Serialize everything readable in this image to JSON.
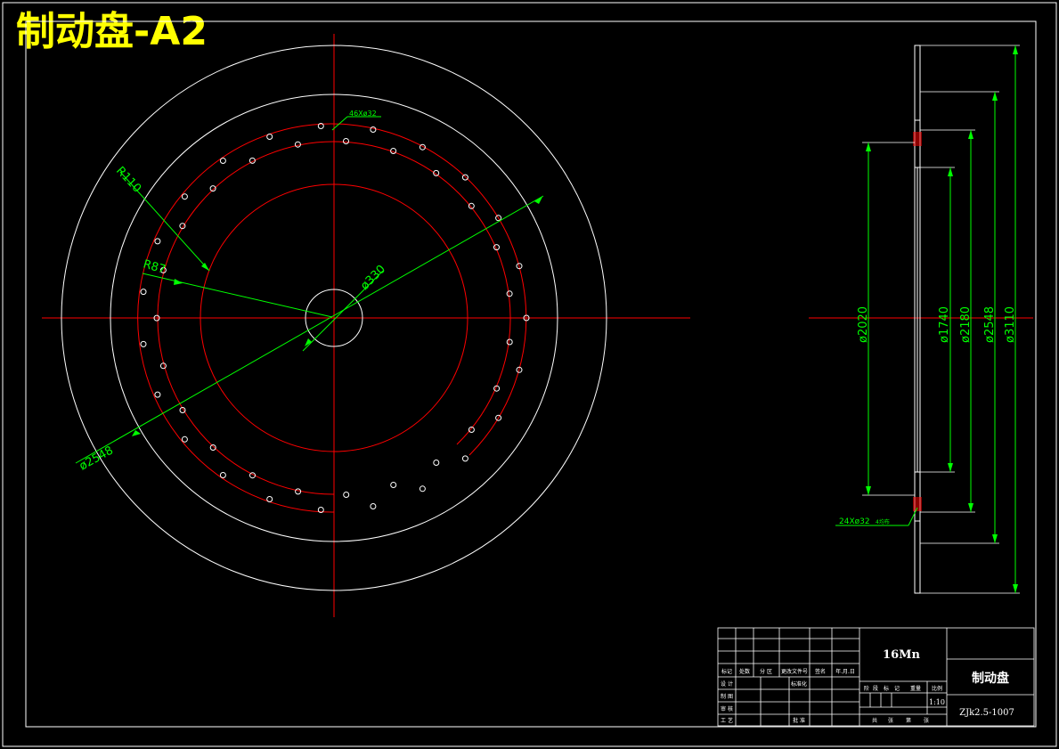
{
  "page": {
    "title": "制动盘-A2"
  },
  "colors": {
    "background": "#000000",
    "outline": "#ffffff",
    "center_line": "#ff0000",
    "dimension": "#00ff00",
    "title_text": "#ffff00"
  },
  "front_view": {
    "hole_note": "46Xø32",
    "dimensions": {
      "r110": "R110",
      "r87": "R87",
      "d330": "ø330",
      "d2548": "ø2548"
    }
  },
  "side_view": {
    "dimensions": {
      "d2020": "ø2020",
      "d1740": "ø1740",
      "d2180": "ø2180",
      "d2548": "ø2548",
      "d3110": "ø3110"
    },
    "hole_note": "24Xø32",
    "hole_note_sub": "4均布"
  },
  "title_block": {
    "material": "16Mn",
    "part_name": "制动盘",
    "drawing_number": "ZJk2.5-1007",
    "scale": "1:10",
    "row_labels": [
      "标记",
      "处数",
      "分 区",
      "更改文件号",
      "签名",
      "年.月.日"
    ],
    "left_labels": [
      "设 计",
      "制 图",
      "审 核",
      "工 艺"
    ],
    "standardization": "标准化",
    "approval": "批 准",
    "stage_labels": [
      "阶",
      "段",
      "标",
      "记",
      "重量",
      "比例"
    ],
    "sheet_labels": [
      "共",
      "张",
      "第",
      "张"
    ]
  }
}
